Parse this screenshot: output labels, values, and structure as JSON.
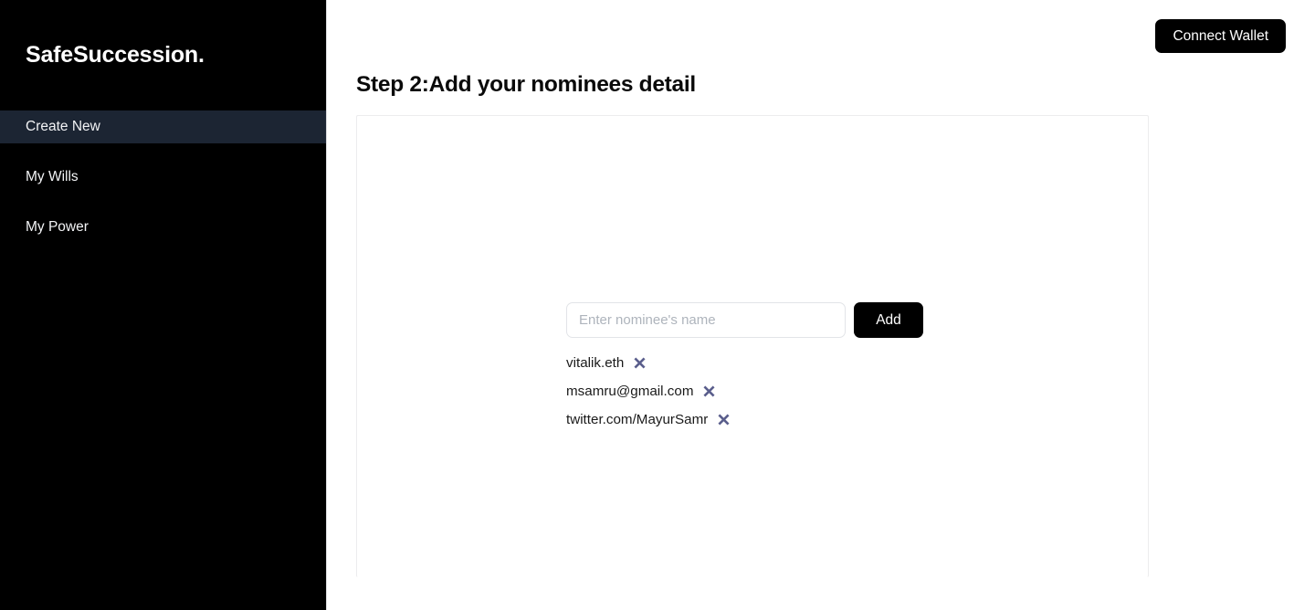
{
  "brand": {
    "name": "SafeSuccession."
  },
  "sidebar": {
    "items": [
      {
        "label": "Create New",
        "active": true
      },
      {
        "label": "My Wills",
        "active": false
      },
      {
        "label": "My Power",
        "active": false
      }
    ]
  },
  "topbar": {
    "connect_wallet_label": "Connect Wallet"
  },
  "main": {
    "page_title": "Step 2:Add your nominees detail",
    "form": {
      "input_placeholder": "Enter nominee's name",
      "input_value": "",
      "add_button_label": "Add"
    },
    "nominees": [
      {
        "name": "vitalik.eth",
        "remove_icon": "close-icon"
      },
      {
        "name": "msamru@gmail.com",
        "remove_icon": "close-icon"
      },
      {
        "name": "twitter.com/MayurSamr",
        "remove_icon": "close-icon"
      }
    ]
  },
  "colors": {
    "sidebar_bg": "#000000",
    "sidebar_active_bg": "#1c2533",
    "accent_black": "#000000",
    "remove_icon": "#5a5e8c",
    "card_border": "#ececee",
    "placeholder": "#aeb4bc"
  }
}
